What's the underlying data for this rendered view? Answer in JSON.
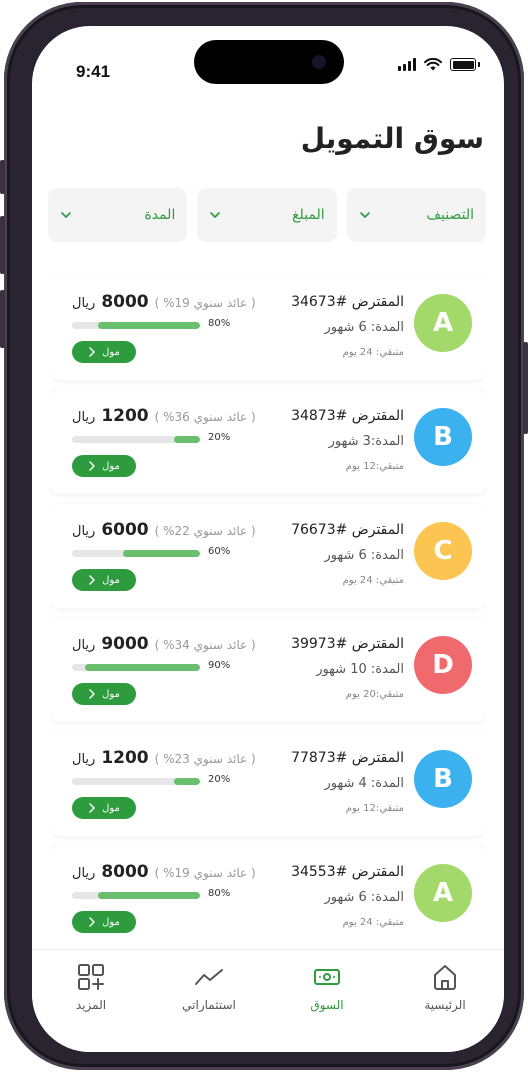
{
  "status": {
    "time": "9:41"
  },
  "page": {
    "title": "سوق التمويل"
  },
  "filters": [
    {
      "label": "التصنيف"
    },
    {
      "label": "المبلغ"
    },
    {
      "label": "المدة"
    }
  ],
  "loans": [
    {
      "grade": "A",
      "color": "#a3d96b",
      "borrower": "المقترض #34673",
      "duration": "المدة: 6 شهور",
      "remaining": "متبقي: 24 يوم",
      "amount": "8000",
      "currency": "ريال",
      "yield": "( عائد سنوي 19% )",
      "progress": 0.8,
      "percent": "80%",
      "cta": "مول"
    },
    {
      "grade": "B",
      "color": "#3bb1ef",
      "borrower": "المقترض #34873",
      "duration": "المدة:3 شهور",
      "remaining": "متبقي:12 يوم",
      "amount": "1200",
      "currency": "ريال",
      "yield": "( عائد سنوي 36% )",
      "progress": 0.2,
      "percent": "20%",
      "cta": "مول"
    },
    {
      "grade": "C",
      "color": "#fcc451",
      "borrower": "المقترض #76673",
      "duration": "المدة: 6 شهور",
      "remaining": "متبقي: 24 يوم",
      "amount": "6000",
      "currency": "ريال",
      "yield": "( عائد سنوي 22% )",
      "progress": 0.6,
      "percent": "60%",
      "cta": "مول"
    },
    {
      "grade": "D",
      "color": "#f06a6d",
      "borrower": "المقترض #39973",
      "duration": "المدة: 10 شهور",
      "remaining": "متبقي:20 يوم",
      "amount": "9000",
      "currency": "ريال",
      "yield": "( عائد سنوي 34% )",
      "progress": 0.9,
      "percent": "90%",
      "cta": "مول"
    },
    {
      "grade": "B",
      "color": "#3bb1ef",
      "borrower": "المقترض #77873",
      "duration": "المدة: 4 شهور",
      "remaining": "متبقي:12 يوم",
      "amount": "1200",
      "currency": "ريال",
      "yield": "( عائد سنوي 23% )",
      "progress": 0.2,
      "percent": "20%",
      "cta": "مول"
    },
    {
      "grade": "A",
      "color": "#a3d96b",
      "borrower": "المقترض #34553",
      "duration": "المدة: 6 شهور",
      "remaining": "متبقي: 24 يوم",
      "amount": "8000",
      "currency": "ريال",
      "yield": "( عائد سنوي 19% )",
      "progress": 0.8,
      "percent": "80%",
      "cta": "مول"
    }
  ],
  "tabs": [
    {
      "label": "الرئيسية",
      "icon": "home-icon"
    },
    {
      "label": "السوق",
      "icon": "money-icon",
      "active": true
    },
    {
      "label": "استثماراتي",
      "icon": "chart-line-icon"
    },
    {
      "label": "المزيد",
      "icon": "grid-add-icon"
    }
  ],
  "colors": {
    "accent": "#2f9b3f",
    "progress": "#6abf6f"
  }
}
